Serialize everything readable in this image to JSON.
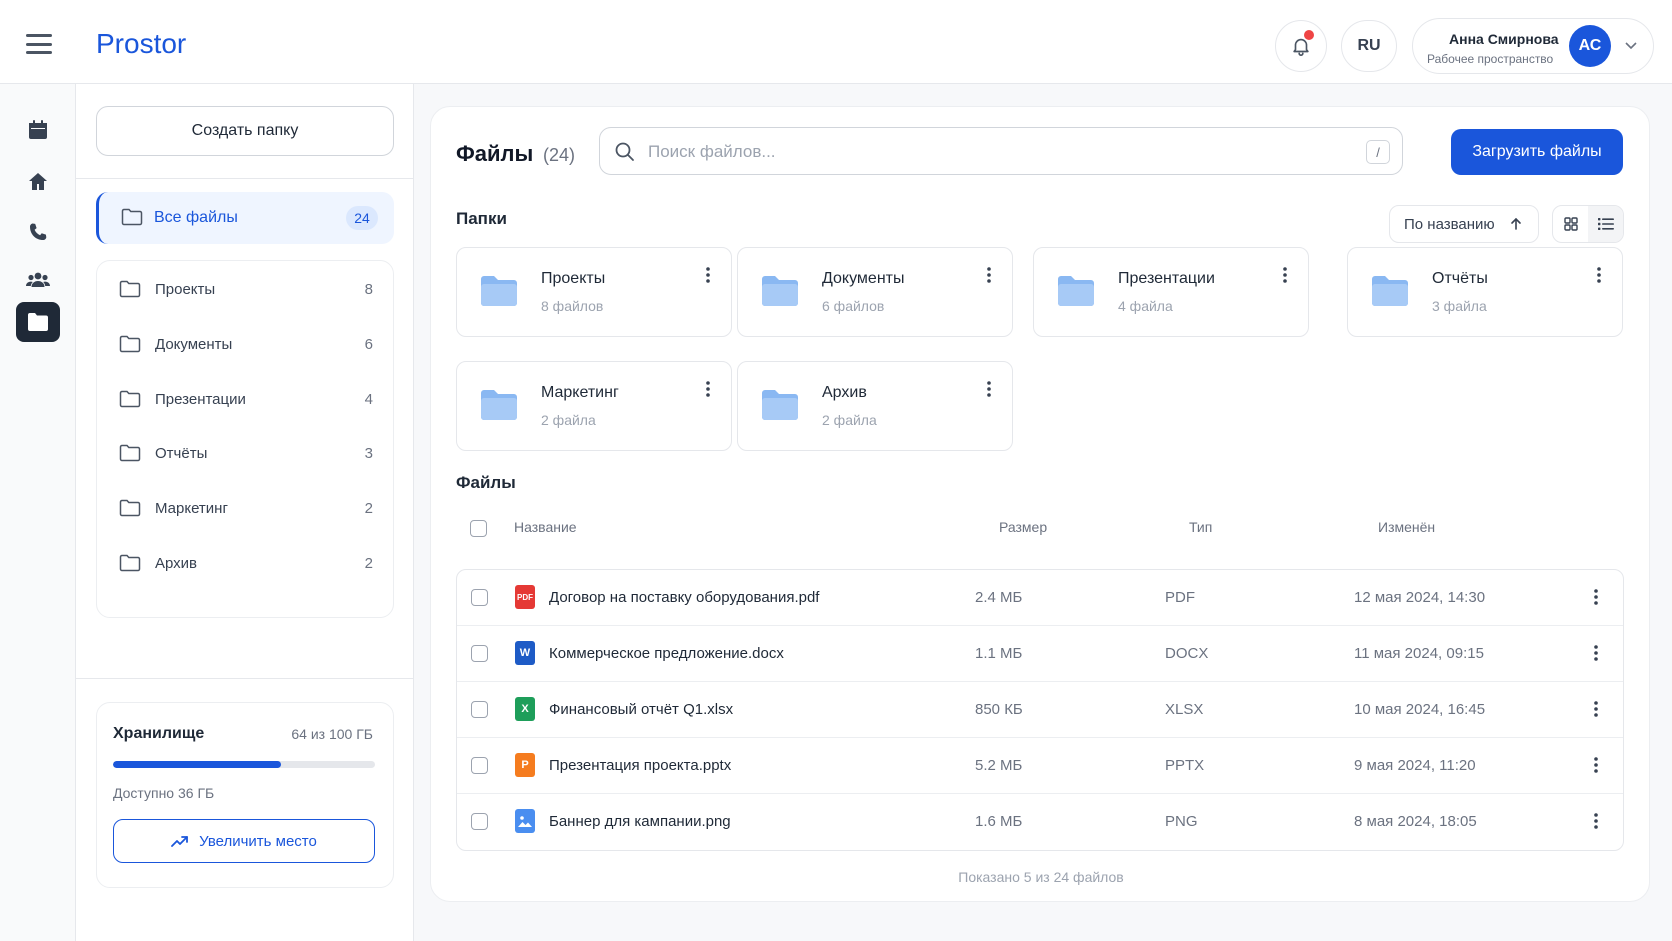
{
  "header": {
    "brand": "Prostor",
    "lang": "RU",
    "user_name": "Анна Смирнова",
    "workspace": "Рабочее пространство",
    "avatar_initials": "АС",
    "accent": "#1a56db"
  },
  "rail": {
    "items": [
      {
        "icon": "calendar-icon"
      },
      {
        "icon": "home-icon"
      },
      {
        "icon": "phone-icon"
      },
      {
        "icon": "users-icon"
      },
      {
        "icon": "folder-icon",
        "active": true
      }
    ]
  },
  "sidebar": {
    "create_label": "Создать папку",
    "all_files": {
      "label": "Все файлы",
      "count": "24"
    },
    "folders": [
      {
        "label": "Проекты",
        "count": "8"
      },
      {
        "label": "Документы",
        "count": "6"
      },
      {
        "label": "Презентации",
        "count": "4"
      },
      {
        "label": "Отчёты",
        "count": "3"
      },
      {
        "label": "Маркетинг",
        "count": "2"
      },
      {
        "label": "Архив",
        "count": "2"
      }
    ],
    "storage": {
      "title": "Хранилище",
      "used_text": "64 из 100 ГБ",
      "used_fraction": 0.64,
      "available": "Доступно 36 ГБ",
      "upgrade_label": "Увеличить место"
    }
  },
  "main": {
    "title": "Файлы",
    "count": "(24)",
    "search_placeholder": "Поиск файлов...",
    "search_shortcut": "/",
    "upload_label": "Загрузить файлы",
    "folders_title": "Папки",
    "sort_label": "По названию",
    "folders": [
      {
        "name": "Проекты",
        "count": "8 файлов"
      },
      {
        "name": "Документы",
        "count": "6 файлов"
      },
      {
        "name": "Презентации",
        "count": "4 файла"
      },
      {
        "name": "Отчёты",
        "count": "3 файла"
      },
      {
        "name": "Маркетинг",
        "count": "2 файла"
      },
      {
        "name": "Архив",
        "count": "2 файла"
      }
    ],
    "files_title": "Файлы",
    "columns": {
      "name": "Название",
      "size": "Размер",
      "type": "Тип",
      "modified": "Изменён"
    },
    "files": [
      {
        "name": "Договор на поставку оборудования.pdf",
        "size": "2.4 МБ",
        "type": "PDF",
        "modified": "12 мая 2024, 14:30",
        "icon_label": "PDF",
        "icon_color": "#e53935"
      },
      {
        "name": "Коммерческое предложение.docx",
        "size": "1.1 МБ",
        "type": "DOCX",
        "modified": "11 мая 2024, 09:15",
        "icon_label": "W",
        "icon_color": "#1e5bc6"
      },
      {
        "name": "Финансовый отчёт Q1.xlsx",
        "size": "850 КБ",
        "type": "XLSX",
        "modified": "10 мая 2024, 16:45",
        "icon_label": "X",
        "icon_color": "#1e9e5a"
      },
      {
        "name": "Презентация проекта.pptx",
        "size": "5.2 МБ",
        "type": "PPTX",
        "modified": "9 мая 2024, 11:20",
        "icon_label": "P",
        "icon_color": "#f57c1f"
      },
      {
        "name": "Баннер для кампании.png",
        "size": "1.6 МБ",
        "type": "PNG",
        "modified": "8 мая 2024, 18:05",
        "icon_label": "",
        "icon_color": "#4a8ef0"
      }
    ],
    "footer": "Показано 5 из 24 файлов"
  }
}
